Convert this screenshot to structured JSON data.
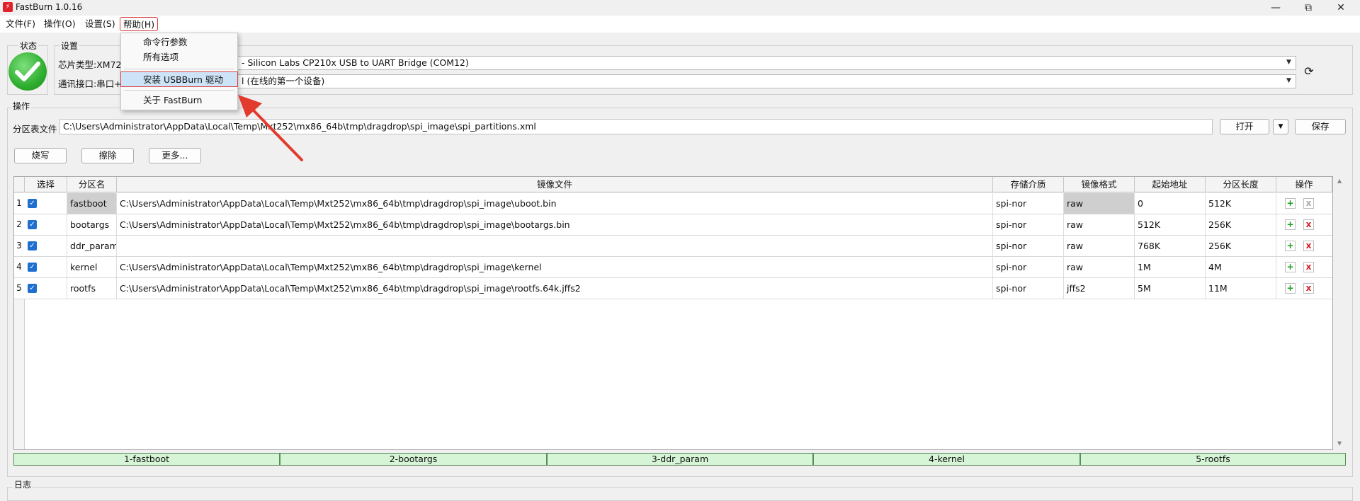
{
  "window": {
    "title": "FastBurn 1.0.16",
    "app_icon": "lightning-icon",
    "controls": {
      "minimize": "—",
      "restore": "⧉",
      "close": "✕"
    }
  },
  "menu": {
    "file": "文件(F)",
    "operate": "操作(O)",
    "settings": "设置(S)",
    "help": "帮助(H)"
  },
  "help_menu": {
    "items": [
      "命令行参数",
      "所有选项",
      "安装 USBBurn 驱动",
      "关于 FastBurn"
    ]
  },
  "status_group": {
    "label": "状态"
  },
  "settings_group": {
    "label": "设置",
    "chip_label": "芯片类型:XM72",
    "port_value": "- Silicon Labs CP210x USB to UART Bridge (COM12)",
    "iface_label": "通讯接口:串口+",
    "device_value": "l (在线的第一个设备)"
  },
  "ops_group": {
    "label": "操作",
    "partfile_label": "分区表文件",
    "partfile_value": "C:\\Users\\Administrator\\AppData\\Local\\Temp\\Mxt252\\mx86_64b\\tmp\\dragdrop\\spi_image\\spi_partitions.xml",
    "open_label": "打开",
    "save_label": "保存",
    "burn_label": "烧写",
    "erase_label": "擦除",
    "more_label": "更多..."
  },
  "table": {
    "headers": [
      "选择",
      "分区名",
      "镜像文件",
      "存储介质",
      "镜像格式",
      "起始地址",
      "分区长度",
      "操作"
    ],
    "rows": [
      {
        "num": "1",
        "name": "fastboot",
        "file": "C:\\Users\\Administrator\\AppData\\Local\\Temp\\Mxt252\\mx86_64b\\tmp\\dragdrop\\spi_image\\uboot.bin",
        "media": "spi-nor",
        "format": "raw",
        "start": "0",
        "length": "512K"
      },
      {
        "num": "2",
        "name": "bootargs",
        "file": "C:\\Users\\Administrator\\AppData\\Local\\Temp\\Mxt252\\mx86_64b\\tmp\\dragdrop\\spi_image\\bootargs.bin",
        "media": "spi-nor",
        "format": "raw",
        "start": "512K",
        "length": "256K"
      },
      {
        "num": "3",
        "name": "ddr_param",
        "file": "",
        "media": "spi-nor",
        "format": "raw",
        "start": "768K",
        "length": "256K"
      },
      {
        "num": "4",
        "name": "kernel",
        "file": "C:\\Users\\Administrator\\AppData\\Local\\Temp\\Mxt252\\mx86_64b\\tmp\\dragdrop\\spi_image\\kernel",
        "media": "spi-nor",
        "format": "raw",
        "start": "1M",
        "length": "4M"
      },
      {
        "num": "5",
        "name": "rootfs",
        "file": "C:\\Users\\Administrator\\AppData\\Local\\Temp\\Mxt252\\mx86_64b\\tmp\\dragdrop\\spi_image\\rootfs.64k.jffs2",
        "media": "spi-nor",
        "format": "jffs2",
        "start": "5M",
        "length": "11M"
      }
    ]
  },
  "progress": [
    "1-fastboot",
    "2-bootargs",
    "3-ddr_param",
    "4-kernel",
    "5-rootfs"
  ],
  "log_group": {
    "label": "日志"
  },
  "colors": {
    "accent": "#1f6fd0",
    "progress_fill": "#d6f5d6",
    "annotation": "#e23b2e"
  }
}
